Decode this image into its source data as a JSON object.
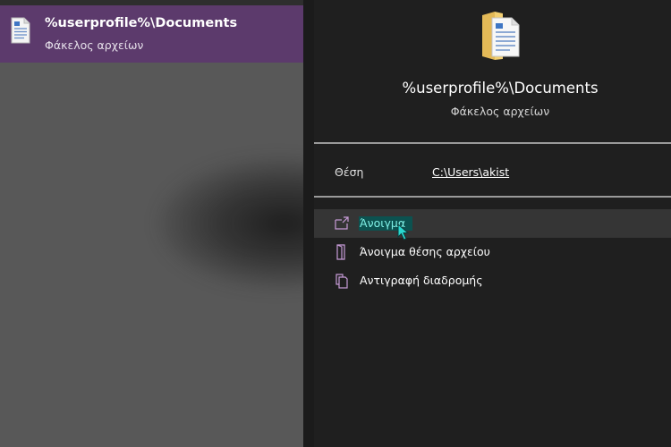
{
  "result": {
    "title": "%userprofile%\\Documents",
    "subtitle": "Φάκελος αρχείων",
    "icon": "document-icon"
  },
  "details": {
    "title": "%userprofile%\\Documents",
    "subtitle": "Φάκελος αρχείων",
    "icon": "folder-icon",
    "location_label": "Θέση",
    "location_value": "C:\\Users\\akist"
  },
  "actions": [
    {
      "label": "Άνοιγμα",
      "icon": "open-icon",
      "hovered": true
    },
    {
      "label": "Άνοιγμα θέσης αρχείου",
      "icon": "folder-open-icon",
      "hovered": false
    },
    {
      "label": "Αντιγραφή διαδρομής",
      "icon": "copy-icon",
      "hovered": false
    }
  ],
  "colors": {
    "accent_selected": "#5c3a6c",
    "icon_purple": "#c89cd8",
    "hover_label_bg": "#0c5250",
    "hover_label_fg": "#7ff0e6",
    "cursor": "#2ad7cf"
  }
}
